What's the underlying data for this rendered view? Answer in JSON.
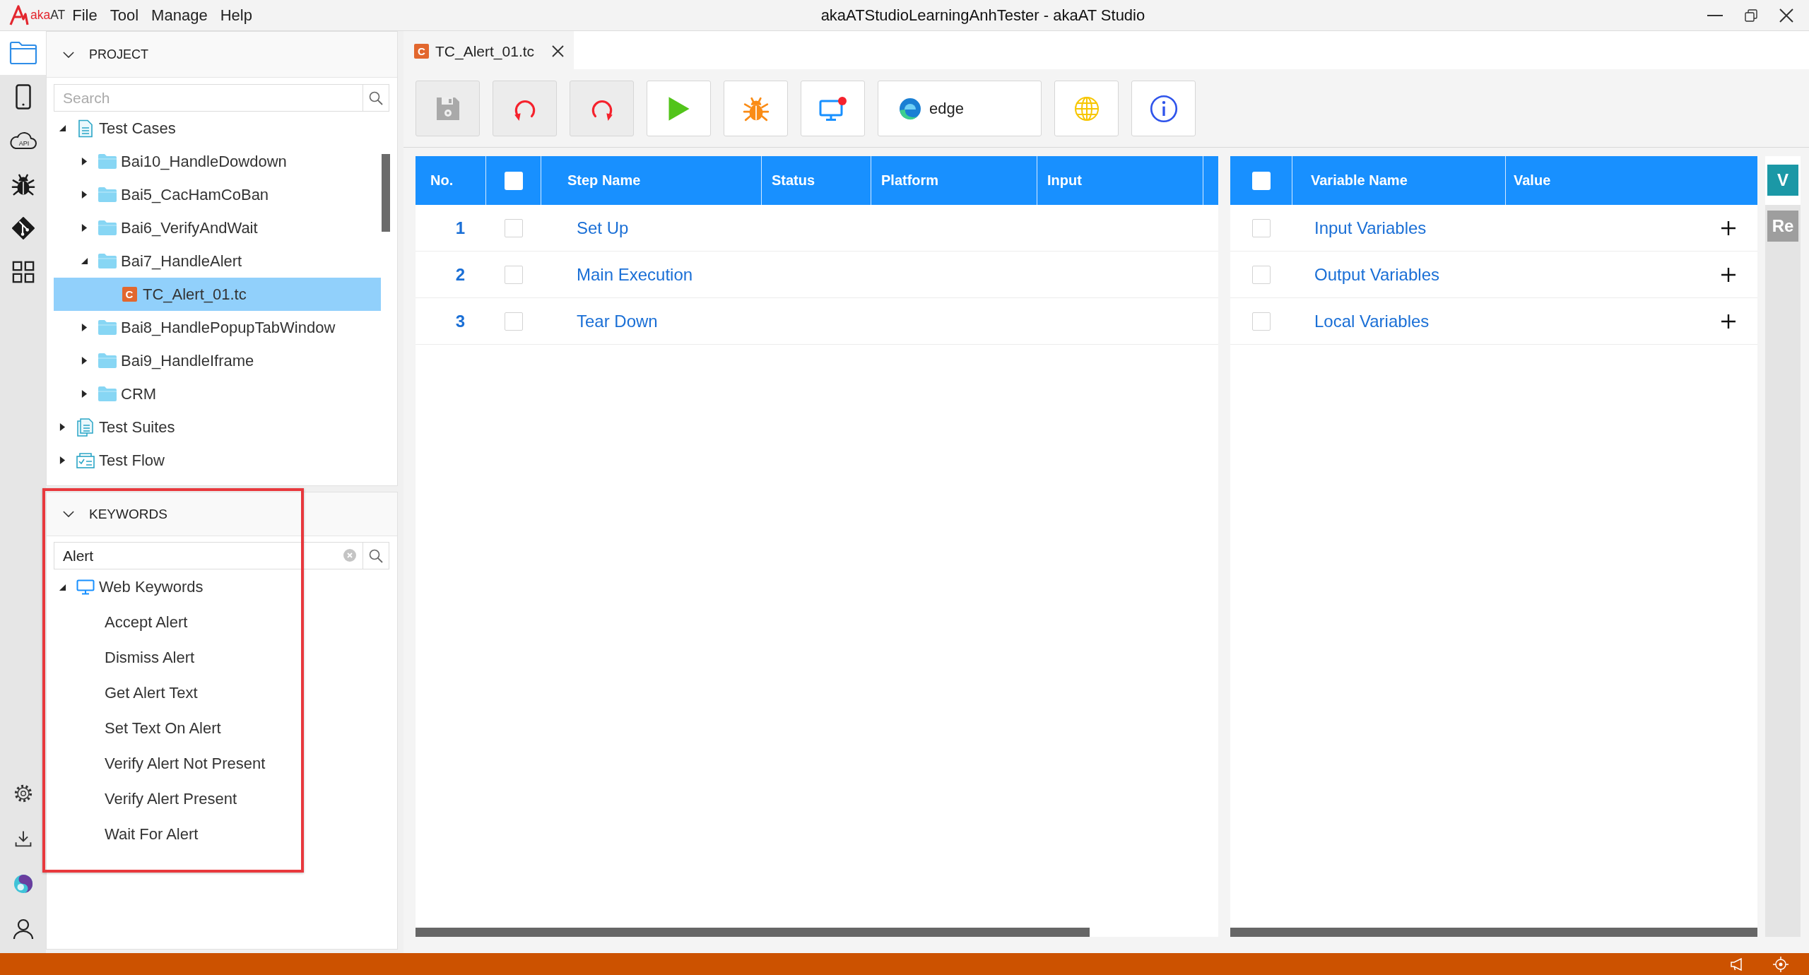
{
  "title_bar": {
    "brand": {
      "prefix": "aka",
      "suffix": "AT"
    },
    "menu": [
      "File",
      "Tool",
      "Manage",
      "Help"
    ],
    "title": "akaATStudioLearningAnhTester - akaAT Studio"
  },
  "activity_bar": {
    "items": [
      {
        "kind": "explorer",
        "selected": true
      },
      {
        "kind": "mobile",
        "selected": false
      },
      {
        "kind": "api",
        "label": "API",
        "selected": false
      },
      {
        "kind": "debug",
        "selected": false
      },
      {
        "kind": "git",
        "selected": false
      },
      {
        "kind": "extensions",
        "selected": false
      }
    ],
    "bottom_items": [
      {
        "kind": "settings"
      },
      {
        "kind": "download"
      },
      {
        "kind": "account-logo"
      },
      {
        "kind": "user"
      }
    ]
  },
  "project": {
    "title": "PROJECT",
    "expanded": true,
    "search": {
      "placeholder": "Search"
    },
    "tree": [
      {
        "label": "Test Cases",
        "kind": "test-cases",
        "expanded": true,
        "selected": false,
        "children": [
          {
            "label": "Bai10_HandleDowdown",
            "kind": "folder",
            "expanded": false,
            "selected": false
          },
          {
            "label": "Bai5_CacHamCoBan",
            "kind": "folder",
            "expanded": false,
            "selected": false
          },
          {
            "label": "Bai6_VerifyAndWait",
            "kind": "folder",
            "expanded": false,
            "selected": false
          },
          {
            "label": "Bai7_HandleAlert",
            "kind": "folder",
            "expanded": true,
            "selected": false,
            "children": [
              {
                "label": "TC_Alert_01.tc",
                "kind": "test-case-file",
                "badge": "C",
                "selected": true
              }
            ]
          },
          {
            "label": "Bai8_HandlePopupTabWindow",
            "kind": "folder",
            "expanded": false,
            "selected": false
          },
          {
            "label": "Bai9_HandleIframe",
            "kind": "folder",
            "expanded": false,
            "selected": false
          },
          {
            "label": "CRM",
            "kind": "folder",
            "expanded": false,
            "selected": false
          }
        ]
      },
      {
        "label": "Test Suites",
        "kind": "test-suites",
        "expanded": false,
        "selected": false
      },
      {
        "label": "Test Flow",
        "kind": "test-flow",
        "expanded": false,
        "selected": false
      }
    ]
  },
  "keywords": {
    "title": "KEYWORDS",
    "expanded": true,
    "highlighted": true,
    "search": {
      "value": "Alert"
    },
    "tree": [
      {
        "label": "Web Keywords",
        "kind": "web",
        "expanded": true,
        "selected": false,
        "children": [
          {
            "label": "Accept Alert",
            "selected": false
          },
          {
            "label": "Dismiss Alert",
            "selected": false
          },
          {
            "label": "Get Alert Text",
            "selected": false
          },
          {
            "label": "Set Text On Alert",
            "selected": false
          },
          {
            "label": "Verify Alert Not Present",
            "selected": false
          },
          {
            "label": "Verify Alert Present",
            "selected": false
          },
          {
            "label": "Wait For Alert",
            "selected": false
          }
        ]
      }
    ]
  },
  "editor": {
    "tabs": [
      {
        "label": "TC_Alert_01.tc",
        "badge": "C",
        "selected": true
      }
    ],
    "toolbar": [
      {
        "kind": "save",
        "disabled": true
      },
      {
        "kind": "undo",
        "disabled": true
      },
      {
        "kind": "redo",
        "disabled": true
      },
      {
        "kind": "run",
        "disabled": false
      },
      {
        "kind": "debug",
        "disabled": false
      },
      {
        "kind": "remote",
        "disabled": false
      },
      {
        "kind": "browser",
        "label": "edge",
        "disabled": false
      },
      {
        "kind": "web",
        "disabled": false
      },
      {
        "kind": "info",
        "disabled": false
      }
    ],
    "steps": {
      "columns": [
        {
          "kind": "text",
          "label": "No."
        },
        {
          "kind": "checkbox",
          "checked": false
        },
        {
          "kind": "text",
          "label": "Step Name"
        },
        {
          "kind": "text",
          "label": "Status"
        },
        {
          "kind": "text",
          "label": "Platform"
        },
        {
          "kind": "text",
          "label": "Input"
        }
      ],
      "rows": [
        {
          "no": "1",
          "checked": false,
          "step_name": "Set Up"
        },
        {
          "no": "2",
          "checked": false,
          "step_name": "Main Execution"
        },
        {
          "no": "3",
          "checked": false,
          "step_name": "Tear Down"
        }
      ]
    },
    "variables": {
      "columns": [
        {
          "kind": "checkbox",
          "checked": false
        },
        {
          "kind": "text",
          "label": "Variable Name"
        },
        {
          "kind": "text",
          "label": "Value"
        }
      ],
      "rows": [
        {
          "checked": false,
          "name": "Input Variables"
        },
        {
          "checked": false,
          "name": "Output Variables"
        },
        {
          "checked": false,
          "name": "Local Variables"
        }
      ]
    },
    "side_tabs": [
      {
        "label": "V",
        "selected": true
      },
      {
        "label": "Re",
        "selected": false
      }
    ]
  }
}
